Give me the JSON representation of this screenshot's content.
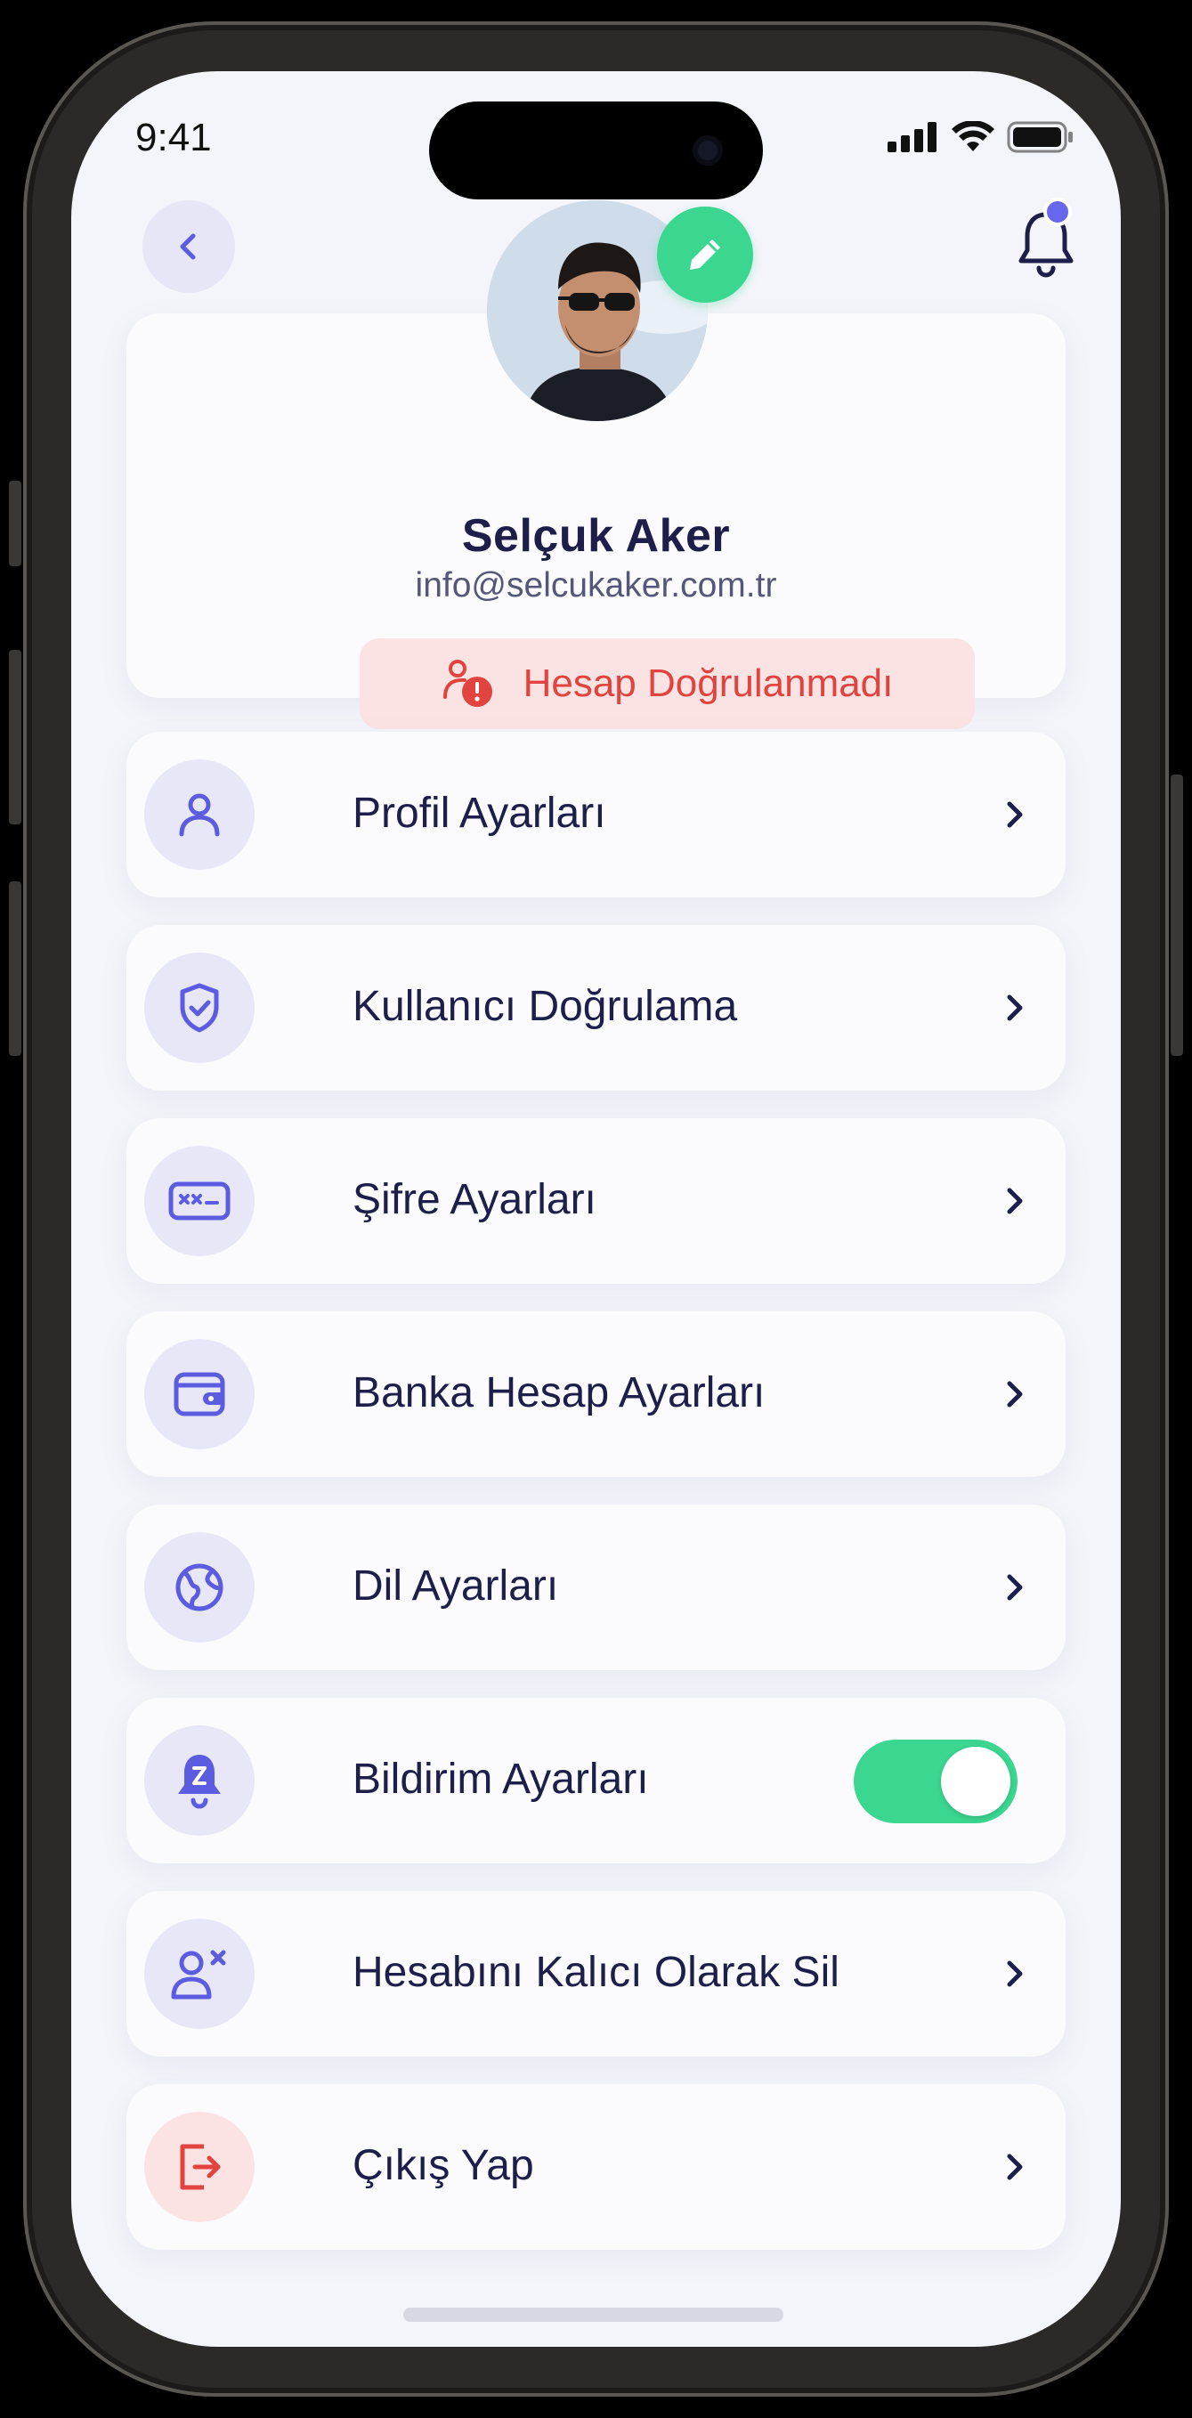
{
  "status_bar": {
    "time": "9:41"
  },
  "header": {
    "back_icon": "chevron-left-icon",
    "notification_icon": "bell-icon",
    "accent": "#6868ee"
  },
  "profile": {
    "name": "Selçuk Aker",
    "email": "info@selcukaker.com.tr",
    "edit_icon": "pencil-icon",
    "verification_status": "Hesap Doğrulanmadı",
    "verification_color": "#e1433f"
  },
  "menu": {
    "items": [
      {
        "label": "Profil Ayarları",
        "icon": "user-icon"
      },
      {
        "label": "Kullanıcı Doğrulama",
        "icon": "shield-check-icon"
      },
      {
        "label": "Şifre Ayarları",
        "icon": "password-field-icon"
      },
      {
        "label": "Banka Hesap Ayarları",
        "icon": "wallet-icon"
      },
      {
        "label": "Dil Ayarları",
        "icon": "globe-icon"
      },
      {
        "label": "Bildirim Ayarları",
        "icon": "bell-snooze-icon",
        "toggle": true
      },
      {
        "label": "Hesabını Kalıcı Olarak Sil",
        "icon": "user-remove-icon"
      },
      {
        "label": "Çıkış Yap",
        "icon": "logout-icon"
      }
    ]
  },
  "colors": {
    "primary": "#5c5ce0",
    "success": "#3bd690",
    "danger": "#e1433f",
    "text": "#1d1f4a"
  }
}
